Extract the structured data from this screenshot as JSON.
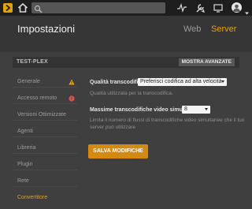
{
  "topbar": {
    "icons": [
      "plex-logo-icon",
      "home-icon",
      "search-icon",
      "activity-icon",
      "settings-tools-icon",
      "cast-icon",
      "user-avatar-icon"
    ]
  },
  "header": {
    "title": "Impostazioni",
    "tabs": [
      {
        "label": "Web",
        "active": false
      },
      {
        "label": "Server",
        "active": true
      }
    ]
  },
  "server_bar": {
    "name": "TEST-PLEX",
    "advanced_button": "MOSTRA AVANZATE"
  },
  "sidebar": {
    "items": [
      {
        "label": "Generale",
        "status": "warning"
      },
      {
        "label": "Accesso remoto",
        "status": "error"
      },
      {
        "label": "Versioni Ottimizzate"
      },
      {
        "label": "Agenti"
      },
      {
        "label": "Libreria"
      },
      {
        "label": "Plugin"
      },
      {
        "label": "Rete"
      },
      {
        "label": "Convertitore",
        "active": true
      }
    ]
  },
  "main": {
    "quality": {
      "label": "Qualità transcodifica",
      "value": "Preferisci codifica ad alta velocità",
      "hint": "Qualità utilizzata per la transcodifica."
    },
    "max_sessions": {
      "label": "Massime transcodifiche video simultanee",
      "value": "8",
      "hint": "Limita il numero di flussi di transcodifiche video simultanee che il tuo server può utilizzare"
    },
    "save_button": "SALVA MODIFICHE"
  },
  "colors": {
    "accent": "#e5a00d",
    "topbar": "#1e1e1e",
    "header": "#363636",
    "content": "#3f3f3f",
    "warning": "#e5a00d",
    "error": "#d9534f"
  }
}
